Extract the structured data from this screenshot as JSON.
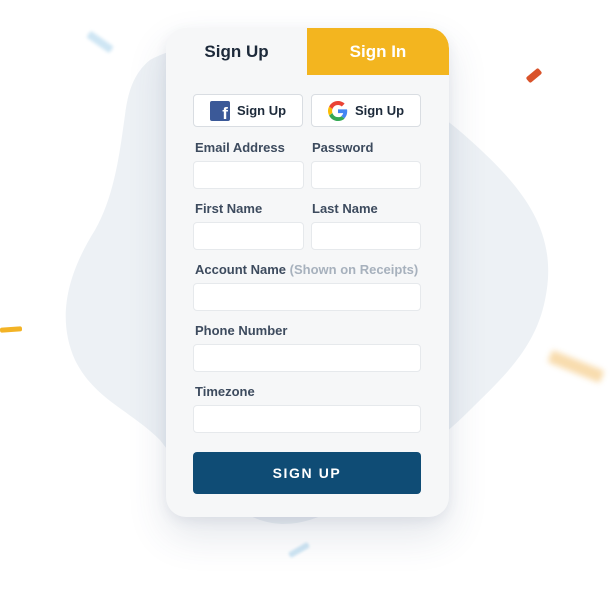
{
  "tabs": {
    "signup_label": "Sign Up",
    "signin_label": "Sign In"
  },
  "social": {
    "facebook_label": "Sign Up",
    "google_label": "Sign Up"
  },
  "fields": {
    "email_label": "Email Address",
    "password_label": "Password",
    "first_name_label": "First Name",
    "last_name_label": "Last Name",
    "account_name_label": "Account Name",
    "account_name_hint": "(Shown on Receipts)",
    "phone_label": "Phone Number",
    "timezone_label": "Timezone",
    "email_value": "",
    "password_value": "",
    "first_name_value": "",
    "last_name_value": "",
    "account_name_value": "",
    "phone_value": "",
    "timezone_value": ""
  },
  "submit_label": "SIGN UP",
  "colors": {
    "accent": "#f3b51f",
    "primary": "#0f4c75",
    "facebook": "#3b5998",
    "card_bg": "#f6f7f8"
  },
  "icons": [
    "facebook-icon",
    "google-icon"
  ]
}
